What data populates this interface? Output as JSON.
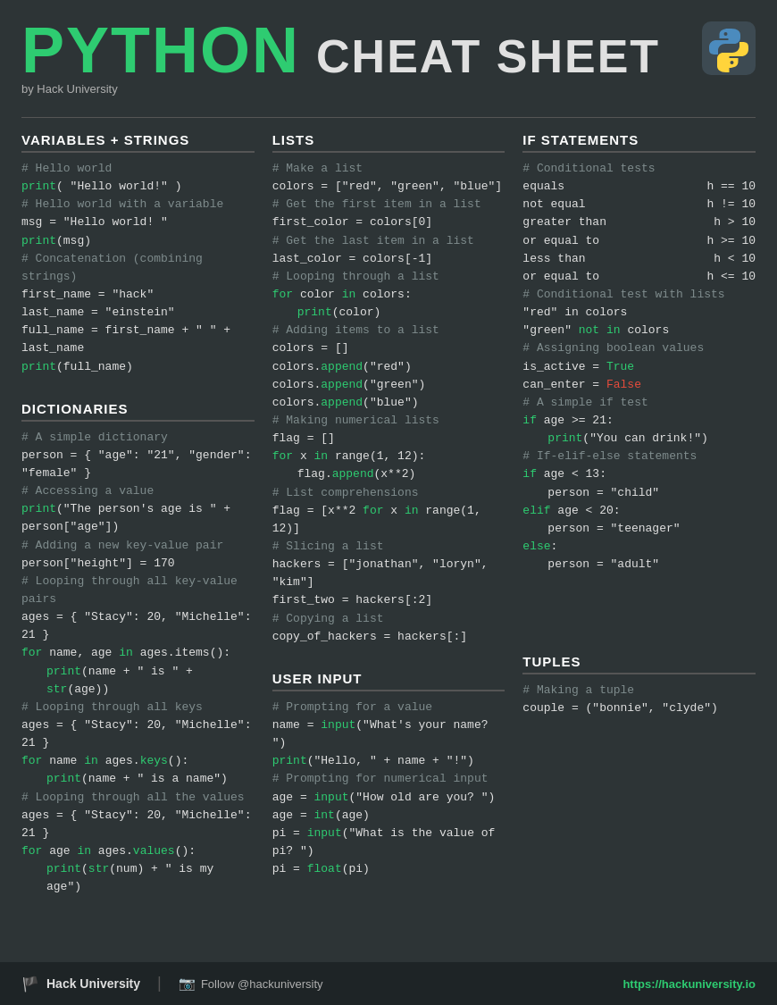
{
  "header": {
    "title_python": "PYTHON",
    "title_cheatsheet": "CHEAT SHEET",
    "subtitle": "by Hack University"
  },
  "footer": {
    "brand": "Hack University",
    "social": "Follow @hackuniversity",
    "url": "https://hackuniversity.io"
  },
  "columns": {
    "col1_title": "VARIABLES + STRINGS",
    "col2_title": "LISTS",
    "col3_title": "IF STATEMENTS"
  }
}
